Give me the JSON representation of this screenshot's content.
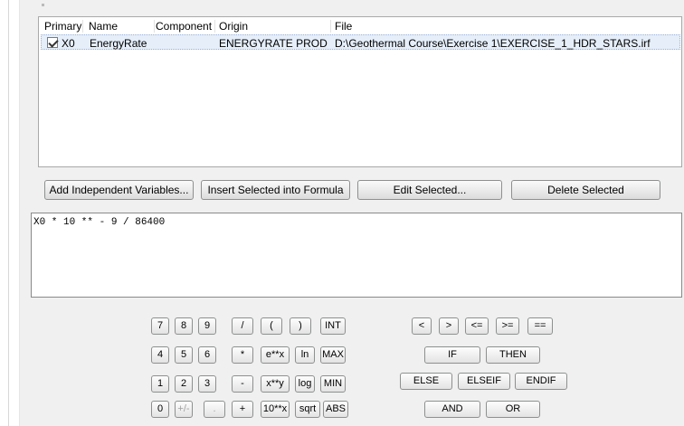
{
  "variables_table": {
    "columns": [
      "Primary",
      "Name",
      "Component",
      "Origin",
      "File"
    ],
    "rows": [
      {
        "primary_checked": true,
        "primary": "X0",
        "name": "EnergyRate",
        "component": "",
        "origin": "ENERGYRATE PROD",
        "file": "D:\\Geothermal Course\\Exercise 1\\EXERCISE_1_HDR_STARS.irf"
      }
    ]
  },
  "buttons": {
    "add_independent": "Add Independent Variables...",
    "insert_selected": "Insert Selected into Formula",
    "edit_selected": "Edit Selected...",
    "delete_selected": "Delete Selected"
  },
  "formula": "X0 * 10 ** - 9 / 86400",
  "keypad": {
    "row1": [
      "7",
      "8",
      "9",
      "/",
      "(",
      ")",
      "INT"
    ],
    "row2": [
      "4",
      "5",
      "6",
      "*",
      "e**x",
      "ln",
      "MAX"
    ],
    "row3": [
      "1",
      "2",
      "3",
      "-",
      "x**y",
      "log",
      "MIN"
    ],
    "row4": [
      "0",
      "+/-",
      ".",
      "+",
      "10**x",
      "sqrt",
      "ABS"
    ]
  },
  "logic": {
    "compare": [
      "<",
      ">",
      "<=",
      ">=",
      "=="
    ],
    "if_label": "IF",
    "then_label": "THEN",
    "else_label": "ELSE",
    "elseif_label": "ELSEIF",
    "endif_label": "ENDIF",
    "and_label": "AND",
    "or_label": "OR"
  }
}
